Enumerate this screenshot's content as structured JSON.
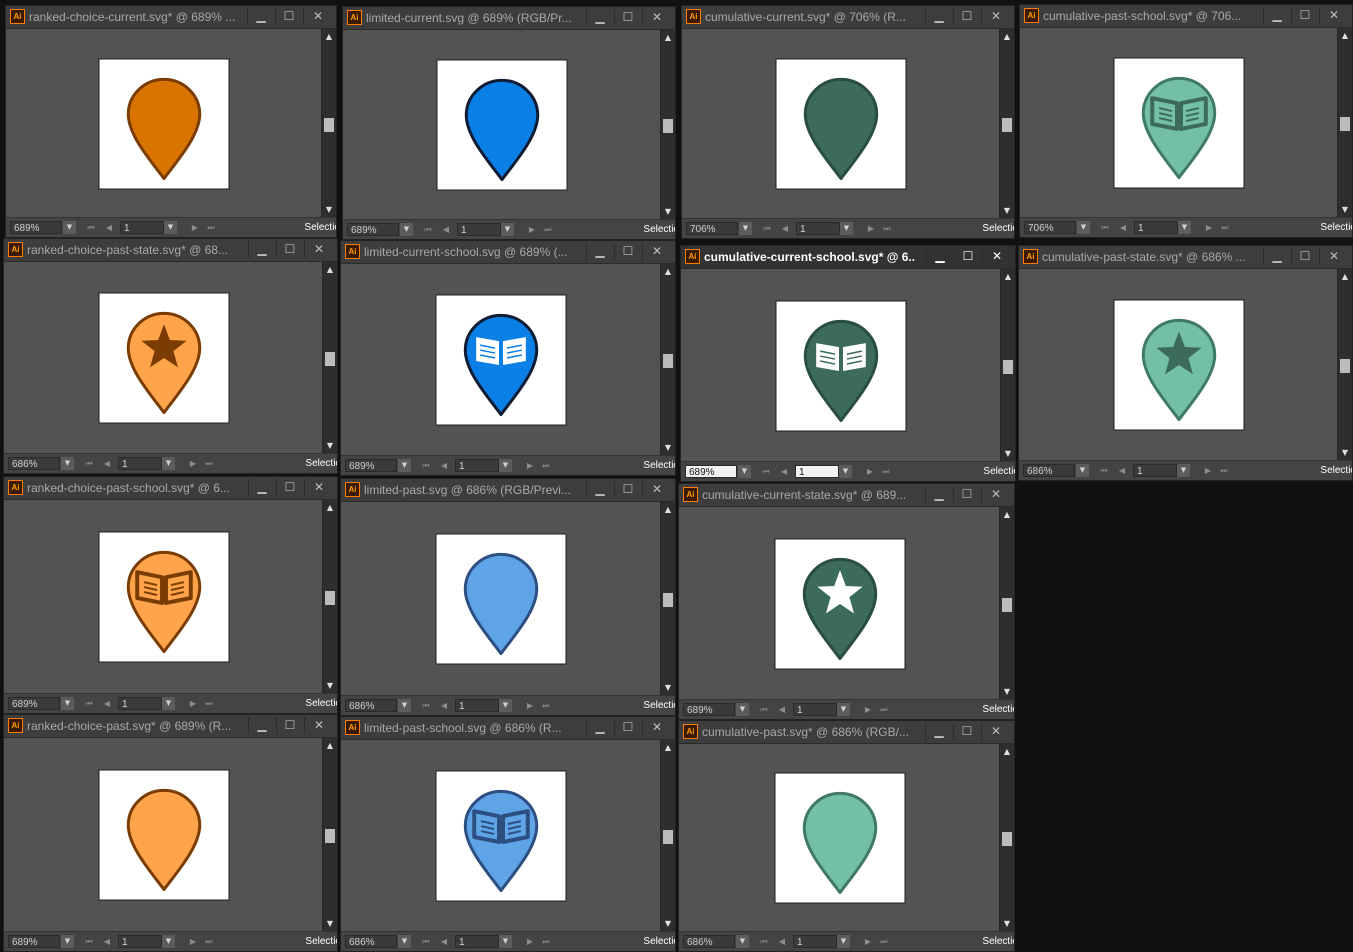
{
  "labels": {
    "status_selection": "Selectio",
    "minimize_glyph": "▁",
    "maximize_glyph": "☐",
    "close_glyph": "✕",
    "app_icon_text": "Ai",
    "nav_first": "⏮",
    "nav_prev": "◀",
    "nav_next": "▶",
    "nav_last": "⏭",
    "dropdown_glyph": "▼",
    "scroll_up_glyph": "▲",
    "scroll_down_glyph": "▼"
  },
  "colors": {
    "orange_dark": "#d97400",
    "orange_light": "#ffa44a",
    "orange_stroke": "#7a3c00",
    "blue_dark": "#0a7fe6",
    "blue_light": "#5ea4e7",
    "blue_stroke": "#0d1b33",
    "blue_stroke_light": "#2d4e80",
    "green_dark": "#3c6b5a",
    "green_light": "#73bfa8",
    "green_stroke": "#2a4d41",
    "green_stroke_light": "#3f7a66"
  },
  "windows": [
    {
      "name": "win-ranked-choice-current",
      "title": "ranked-choice-current.svg* @ 689% ...",
      "zoom": "689%",
      "page": "1",
      "shape": "pin-plain",
      "fill": "orange_dark",
      "stroke": "orange_stroke",
      "emblem": "none",
      "emblem_color": "orange_stroke",
      "scroll_thumb": 0.5,
      "active": false
    },
    {
      "name": "win-limited-current",
      "title": "limited-current.svg @ 689% (RGB/Pr...",
      "zoom": "689%",
      "page": "1",
      "shape": "pin-plain",
      "fill": "blue_dark",
      "stroke": "blue_stroke",
      "emblem": "none",
      "emblem_color": "blue_stroke",
      "scroll_thumb": 0.5,
      "active": false
    },
    {
      "name": "win-cumulative-current",
      "title": "cumulative-current.svg* @ 706% (R...",
      "zoom": "706%",
      "page": "1",
      "shape": "pin-plain",
      "fill": "green_dark",
      "stroke": "green_stroke",
      "emblem": "none",
      "emblem_color": "green_stroke",
      "scroll_thumb": 0.5,
      "active": false
    },
    {
      "name": "win-cumulative-past-school",
      "title": "cumulative-past-school.svg* @ 706...",
      "zoom": "706%",
      "page": "1",
      "shape": "pin",
      "fill": "green_light",
      "stroke": "green_stroke_light",
      "emblem": "book",
      "emblem_color": "green_dark",
      "scroll_thumb": 0.5,
      "active": false
    },
    {
      "name": "win-ranked-choice-past-state",
      "title": "ranked-choice-past-state.svg* @ 68...",
      "zoom": "686%",
      "page": "1",
      "shape": "pin",
      "fill": "orange_light",
      "stroke": "orange_stroke",
      "emblem": "star",
      "emblem_color": "orange_stroke",
      "scroll_thumb": 0.5,
      "active": false
    },
    {
      "name": "win-limited-current-school",
      "title": "limited-current-school.svg @ 689% (...",
      "zoom": "689%",
      "page": "1",
      "shape": "pin",
      "fill": "blue_dark",
      "stroke": "blue_stroke",
      "emblem": "book-white",
      "emblem_color": "blue_stroke",
      "scroll_thumb": 0.5,
      "active": false
    },
    {
      "name": "win-cumulative-current-school",
      "title": "cumulative-current-school.svg* @ 6...",
      "zoom": "689%",
      "page": "1",
      "shape": "pin",
      "fill": "green_dark",
      "stroke": "green_stroke",
      "emblem": "book-white",
      "emblem_color": "green_stroke",
      "scroll_thumb": 0.5,
      "active": true
    },
    {
      "name": "win-cumulative-past-state",
      "title": "cumulative-past-state.svg* @ 686% ...",
      "zoom": "686%",
      "page": "1",
      "shape": "pin",
      "fill": "green_light",
      "stroke": "green_stroke_light",
      "emblem": "star",
      "emblem_color": "green_dark",
      "scroll_thumb": 0.5,
      "active": false
    },
    {
      "name": "win-ranked-choice-past-school",
      "title": "ranked-choice-past-school.svg* @ 6...",
      "zoom": "689%",
      "page": "1",
      "shape": "pin",
      "fill": "orange_light",
      "stroke": "orange_stroke",
      "emblem": "book",
      "emblem_color": "orange_stroke",
      "scroll_thumb": 0.5,
      "active": false
    },
    {
      "name": "win-limited-past",
      "title": "limited-past.svg @ 686% (RGB/Previ...",
      "zoom": "686%",
      "page": "1",
      "shape": "pin-plain",
      "fill": "blue_light",
      "stroke": "blue_stroke_light",
      "emblem": "none",
      "emblem_color": "blue_stroke_light",
      "scroll_thumb": 0.5,
      "active": false
    },
    {
      "name": "win-cumulative-current-state",
      "title": "cumulative-current-state.svg* @ 689...",
      "zoom": "689%",
      "page": "1",
      "shape": "pin",
      "fill": "green_dark",
      "stroke": "green_stroke",
      "emblem": "star-white",
      "emblem_color": "green_stroke",
      "scroll_thumb": 0.5,
      "active": false
    },
    {
      "name": "win-ranked-choice-past",
      "title": "ranked-choice-past.svg* @ 689% (R...",
      "zoom": "689%",
      "page": "1",
      "shape": "pin-plain",
      "fill": "orange_light",
      "stroke": "orange_stroke",
      "emblem": "none",
      "emblem_color": "orange_stroke",
      "scroll_thumb": 0.5,
      "active": false
    },
    {
      "name": "win-limited-past-school",
      "title": "limited-past-school.svg @ 686% (R...",
      "zoom": "686%",
      "page": "1",
      "shape": "pin",
      "fill": "blue_light",
      "stroke": "blue_stroke_light",
      "emblem": "book",
      "emblem_color": "blue_stroke_light",
      "scroll_thumb": 0.5,
      "active": false
    },
    {
      "name": "win-cumulative-past",
      "title": "cumulative-past.svg* @ 686% (RGB/...",
      "zoom": "686%",
      "page": "1",
      "shape": "pin-plain",
      "fill": "green_light",
      "stroke": "green_stroke_light",
      "emblem": "none",
      "emblem_color": "green_stroke_light",
      "scroll_thumb": 0.5,
      "active": false
    }
  ]
}
